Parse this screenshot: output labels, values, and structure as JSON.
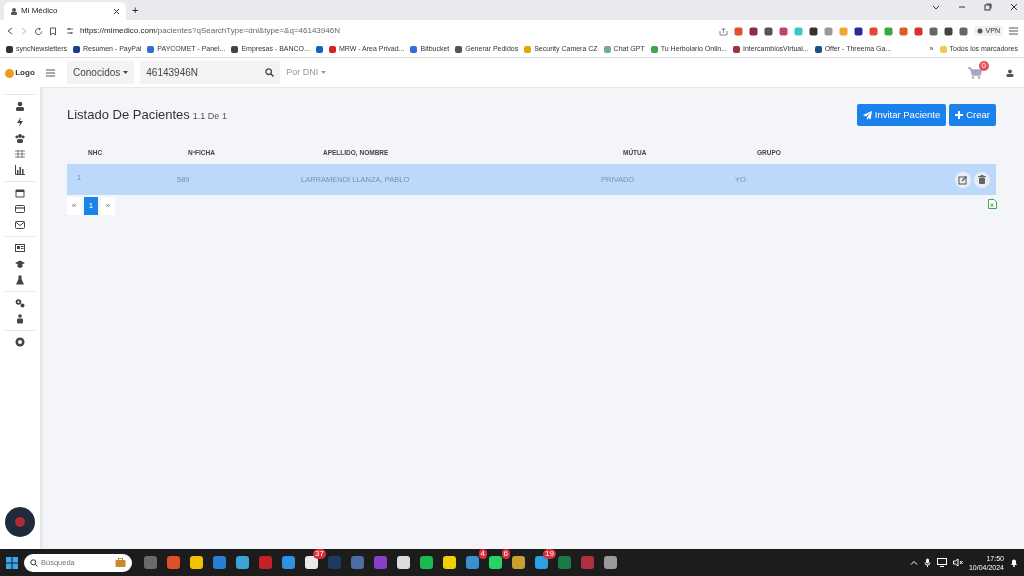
{
  "browser": {
    "tab_title": "Mi Médico",
    "new_tab": "+",
    "url_host": "https://mimedico.com",
    "url_path": "/pacientes?qSearchType=dni&type=&q=46143946N",
    "vpn": "VPN"
  },
  "bookmarks": [
    {
      "label": "syncNewsletters",
      "color": "#333333"
    },
    {
      "label": "Resumen - PayPal",
      "color": "#1a3d8f"
    },
    {
      "label": "PAYCOMET - Panel...",
      "color": "#2f6fd6"
    },
    {
      "label": "Empresas - BANCO...",
      "color": "#444444"
    },
    {
      "color": "#0a66c2"
    },
    {
      "label": "MRW - Area Privad...",
      "color": "#d8202a"
    },
    {
      "label": "Bitbucket",
      "color": "#2f6fd6"
    },
    {
      "label": "Generar Pedidos",
      "color": "#555555"
    },
    {
      "label": "Security Camera CZ",
      "color": "#e0a800"
    },
    {
      "label": "Chat GPT",
      "color": "#74aa9c"
    },
    {
      "label": "Tu Herbolario Onlin...",
      "color": "#3aa84a"
    },
    {
      "label": "IntercambiosVirtual...",
      "color": "#a0303a"
    },
    {
      "label": "Offer - Threema Ga...",
      "color": "#1e4f7a"
    }
  ],
  "bookmarks_more": "»",
  "all_bookmarks": "Todos los marcadores",
  "app": {
    "logo_text": "Logo",
    "filter": "Conocidos",
    "search": {
      "value": "46143946N"
    },
    "search_type": "Por DNI",
    "cart_count": "0"
  },
  "page": {
    "title": "Listado De Pacientes",
    "count": "1.1 De 1"
  },
  "actions": [
    {
      "label": "Invitar Paciente",
      "kind": "invite"
    },
    {
      "label": "Crear",
      "kind": "create"
    }
  ],
  "table": {
    "columns": [
      "NHC",
      "NºFICHA",
      "APELLIDO, NOMBRE",
      "MÚTUA",
      "GRUPO"
    ],
    "rows": [
      {
        "cells": [
          "1",
          "589",
          "LARRAMENDI LLANZA, PABLO",
          "PRIVADO",
          "YO"
        ],
        "selected": true
      }
    ]
  },
  "pagination": [
    {
      "label": "«",
      "selected": false
    },
    {
      "label": "1",
      "selected": true
    },
    {
      "label": "»",
      "selected": false
    }
  ],
  "taskbar": {
    "search_placeholder": "Búsqueda",
    "apps": [
      {
        "color": "#6b6b6b"
      },
      {
        "color": "#e0502a"
      },
      {
        "color": "#f2c200"
      },
      {
        "color": "#2a7fd4"
      },
      {
        "color": "#39a3d8"
      },
      {
        "color": "#c8202a"
      },
      {
        "color": "#2f8fe0"
      },
      {
        "color": "#e9e9e9",
        "badge": "37"
      },
      {
        "color": "#1f3a60"
      },
      {
        "color": "#4a6fa0"
      },
      {
        "color": "#8a3fc8"
      },
      {
        "color": "#dcdcdc"
      },
      {
        "color": "#1db954"
      },
      {
        "color": "#f2d000"
      },
      {
        "color": "#3a8fd0",
        "badge": "4"
      },
      {
        "color": "#25d366",
        "badge": "6"
      },
      {
        "color": "#c8a030"
      },
      {
        "color": "#2aa1e0",
        "badge": "19"
      },
      {
        "color": "#1d7a44"
      },
      {
        "color": "#b03040"
      },
      {
        "color": "#9a9a9a"
      }
    ],
    "time": "17:50",
    "date": "10/04/2024"
  }
}
